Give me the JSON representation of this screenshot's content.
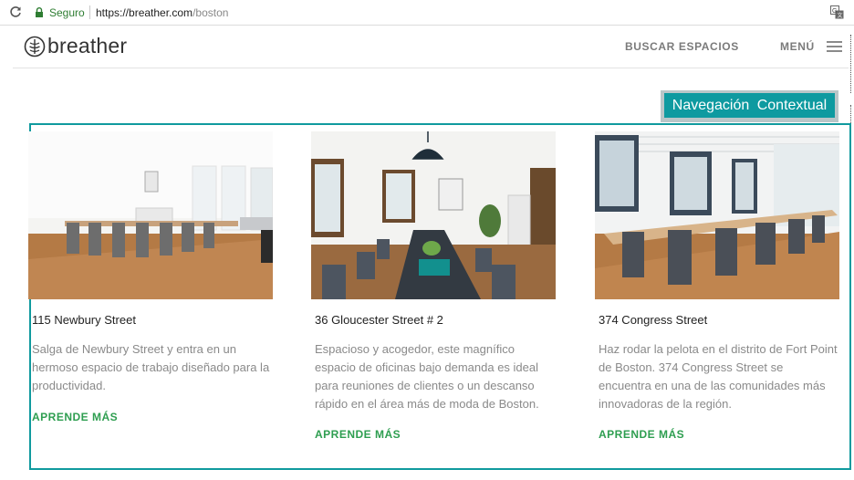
{
  "browser": {
    "secure_label": "Seguro",
    "url_host": "https://breather.com",
    "url_path": "/boston"
  },
  "header": {
    "logo_text": "breather",
    "nav_search": "BUSCAR ESPACIOS",
    "nav_menu": "MENÚ"
  },
  "annotation": {
    "label": "Navegación Contextual"
  },
  "cards": [
    {
      "title": "115 Newbury Street",
      "description": "Salga de Newbury Street y entra en un hermoso espacio de trabajo diseñado para la productividad.",
      "link": "APRENDE MÁS"
    },
    {
      "title": "36 Gloucester Street # 2",
      "description": "Espacioso y acogedor, este magnífico espacio de oficinas bajo demanda es ideal para reuniones de clientes o un descanso rápido en el área más de moda de Boston.",
      "link": "APRENDE MÁS"
    },
    {
      "title": "374 Congress Street",
      "description": "Haz rodar la pelota en el distrito de Fort Point de Boston. 374 Congress Street se encuentra en una de las comunidades más innovadoras de la región.",
      "link": "APRENDE MÁS"
    }
  ],
  "colors": {
    "accent_teal": "#0e9aa0",
    "link_green": "#2e9e50",
    "secure_green": "#2e7d32"
  }
}
